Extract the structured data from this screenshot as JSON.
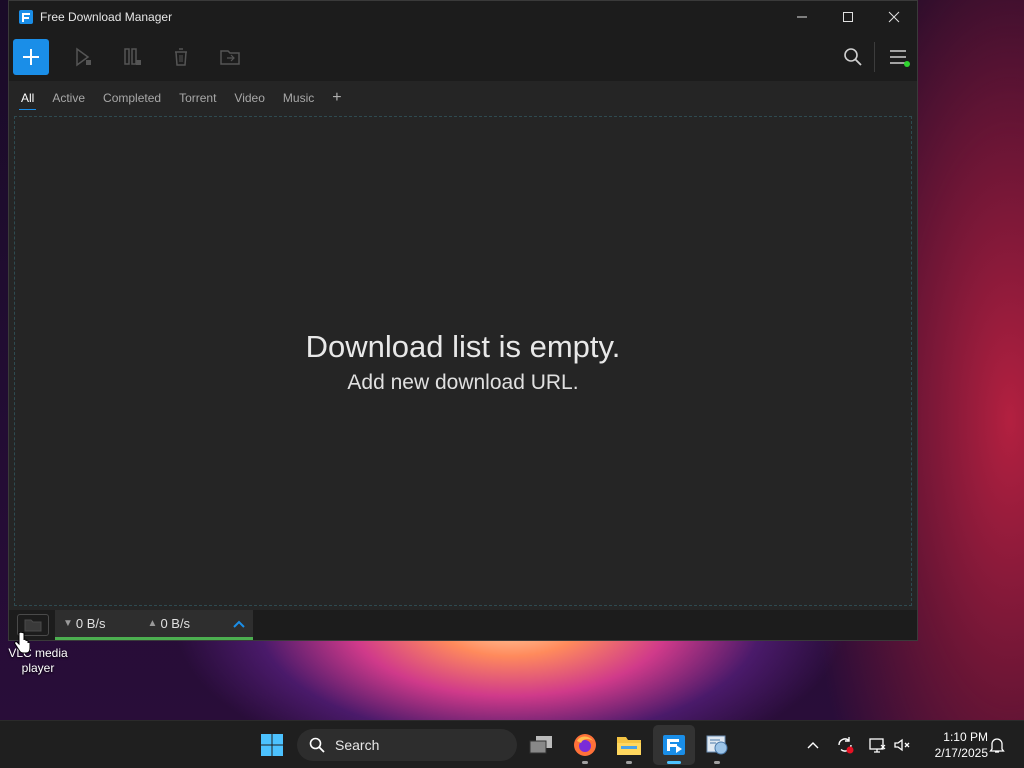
{
  "window": {
    "title": "Free Download Manager"
  },
  "tabs": [
    "All",
    "Active",
    "Completed",
    "Torrent",
    "Video",
    "Music"
  ],
  "tab_add": "+",
  "empty": {
    "title": "Download list is empty.",
    "subtitle": "Add new download URL."
  },
  "status": {
    "download_speed": "0 B/s",
    "upload_speed": "0 B/s",
    "speed_indicator_color": "#4caf50"
  },
  "desktop": {
    "icon_label": "VLC media player"
  },
  "taskbar": {
    "search_label": "Search",
    "time": "1:10 PM",
    "date": "2/17/2025"
  },
  "colors": {
    "accent": "#1a8ee8",
    "status_dot": "#2fd32f"
  }
}
